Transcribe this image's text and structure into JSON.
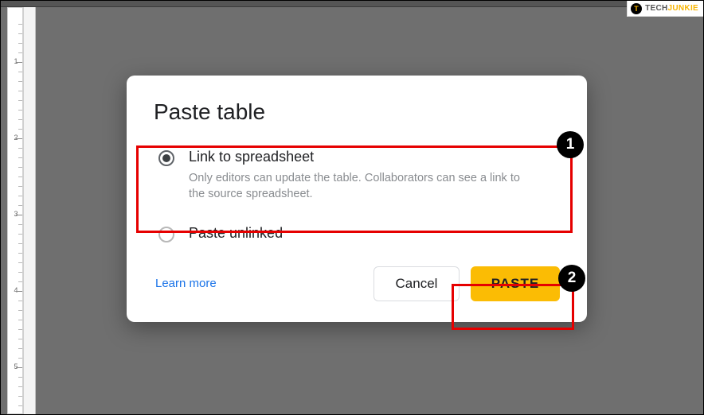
{
  "watermark": {
    "brand_first": "TECH",
    "brand_second": "JUNKIE",
    "icon_letter": "T"
  },
  "dialog": {
    "title": "Paste table",
    "options": {
      "link": {
        "label": "Link to spreadsheet",
        "description": "Only editors can update the table. Collaborators can see a link to the source spreadsheet."
      },
      "unlinked": {
        "label": "Paste unlinked"
      }
    },
    "learn_more": "Learn more",
    "cancel": "Cancel",
    "paste": "PASTE"
  },
  "callouts": {
    "one": "1",
    "two": "2"
  },
  "ruler_numbers": [
    "1",
    "2",
    "3",
    "4",
    "5"
  ]
}
